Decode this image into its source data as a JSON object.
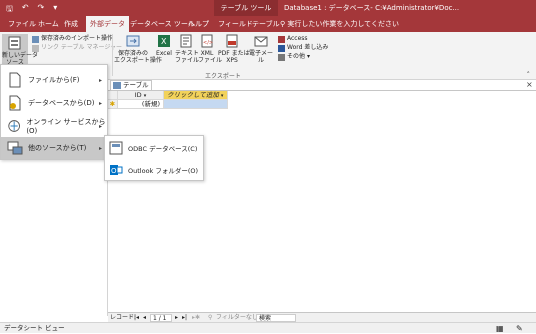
{
  "titlebar": {
    "context_label": "テーブル ツール",
    "doc_title": "Database1 : データベース- C:¥Administrator¥Doc..."
  },
  "tabs": [
    {
      "label": "ファイル"
    },
    {
      "label": "ホーム"
    },
    {
      "label": "作成"
    },
    {
      "label": "外部データ"
    },
    {
      "label": "データベース ツール"
    },
    {
      "label": "ヘルプ"
    },
    {
      "label": "フィールド"
    },
    {
      "label": "テーブル"
    }
  ],
  "tellme": "実行したい作業を入力してください",
  "ribbon": {
    "new_source_label": "新しいデータ\nソース",
    "saved_imports": "保存済みのインポート操作",
    "linked_table_manager": "リンク テーブル マネージャー",
    "saved_exports": "保存済みの\nエクスポート操作",
    "excel": "Excel",
    "text_file": "テキスト\nファイル",
    "xml_file": "XML\nファイル",
    "pdf_xps": "PDF または\nXPS",
    "email": "電子メール",
    "access": "Access",
    "word_merge": "Word 差し込み",
    "other": "その他",
    "export_group": "エクスポート"
  },
  "menu": {
    "items": [
      {
        "label": "ファイルから(F)"
      },
      {
        "label": "データベースから(D)"
      },
      {
        "label": "オンライン サービスから(O)"
      },
      {
        "label": "他のソースから(T)"
      }
    ]
  },
  "submenu": {
    "items": [
      {
        "label": "ODBC データベース(C)"
      },
      {
        "label": "Outlook フォルダー(O)"
      }
    ]
  },
  "doc": {
    "tab_label": "テーブル1",
    "col_id": "ID",
    "col_add": "クリックして追加",
    "new_label": "(新規)"
  },
  "recnav": {
    "label": "レコード:",
    "position": "1 / 1",
    "filter": "フィルターなし",
    "search": "検索"
  },
  "status": {
    "view": "データシート ビュー"
  },
  "colors": {
    "accent": "#a4373a",
    "highlight_cell": "#f2d25b"
  }
}
